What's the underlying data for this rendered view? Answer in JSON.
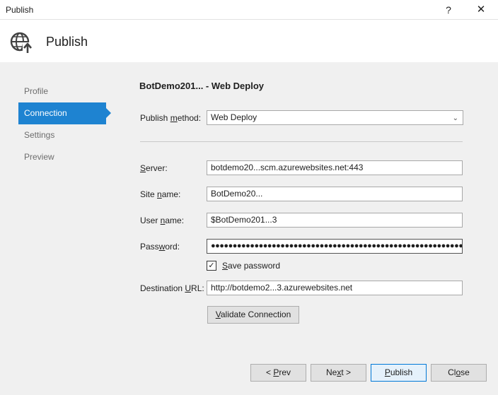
{
  "window": {
    "title": "Publish",
    "help_label": "?",
    "close_label": "✕"
  },
  "header": {
    "title": "Publish",
    "icon": "globe-publish-icon"
  },
  "nav": {
    "items": [
      {
        "label": "Profile"
      },
      {
        "label": "Connection"
      },
      {
        "label": "Settings"
      },
      {
        "label": "Preview"
      }
    ],
    "active_color": "#1e83d1"
  },
  "profile": {
    "title": "BotDemo201... - Web Deploy"
  },
  "publish_method": {
    "label_pre": "Publish ",
    "label_u": "m",
    "label_post": "ethod:",
    "value": "Web Deploy"
  },
  "fields": {
    "server": {
      "label_u": "S",
      "label_post": "erver:",
      "value": "botdemo20...scm.azurewebsites.net:443"
    },
    "site_name": {
      "label_pre": "Site ",
      "label_u": "n",
      "label_post": "ame:",
      "value": "BotDemo20..."
    },
    "user_name": {
      "label_pre": "User ",
      "label_u": "n",
      "label_post": "ame:",
      "value": "$BotDemo201...3"
    },
    "password": {
      "label_pre": "Pass",
      "label_u": "w",
      "label_post": "ord:",
      "value": "●●●●●●●●●●●●●●●●●●●●●●●●●●●●●●●●●●●●●●●●●●●●●●●●●●●●●●●●●●●●"
    },
    "destination_url": {
      "label_pre": "Destination ",
      "label_u": "U",
      "label_post": "RL:",
      "value": "http://botdemo2...3.azurewebsites.net"
    }
  },
  "save_password": {
    "label_u": "S",
    "label_post": "ave password",
    "checked_glyph": "✓"
  },
  "validate": {
    "label_u": "V",
    "label_post": "alidate Connection"
  },
  "footer": {
    "prev_pre": "< ",
    "prev_u": "P",
    "prev_post": "rev",
    "next_pre": "Ne",
    "next_u": "x",
    "next_post": "t >",
    "publish_u": "P",
    "publish_post": "ublish",
    "close_pre": "Cl",
    "close_u": "o",
    "close_post": "se"
  }
}
